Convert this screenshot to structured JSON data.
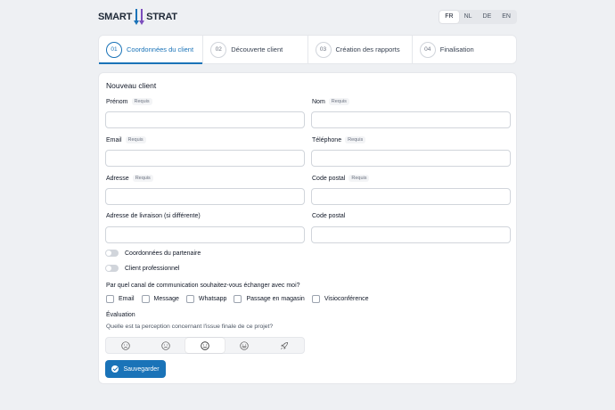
{
  "brand": {
    "left": "SMART",
    "right": "STRAT"
  },
  "languages": [
    {
      "code": "FR",
      "active": true
    },
    {
      "code": "NL",
      "active": false
    },
    {
      "code": "DE",
      "active": false
    },
    {
      "code": "EN",
      "active": false
    }
  ],
  "steps": [
    {
      "num": "01",
      "label": "Coordonnées du client",
      "active": true
    },
    {
      "num": "02",
      "label": "Découverte client",
      "active": false
    },
    {
      "num": "03",
      "label": "Création des rapports",
      "active": false
    },
    {
      "num": "04",
      "label": "Finalisation",
      "active": false
    }
  ],
  "form": {
    "title": "Nouveau client",
    "required_badge": "Requis",
    "fields": {
      "prenom": {
        "label": "Prénom",
        "value": ""
      },
      "nom": {
        "label": "Nom",
        "value": ""
      },
      "email": {
        "label": "Email",
        "value": ""
      },
      "telephone": {
        "label": "Téléphone",
        "value": ""
      },
      "adresse": {
        "label": "Adresse",
        "value": ""
      },
      "code_postal": {
        "label": "Code postal",
        "value": ""
      },
      "adresse_livraison": {
        "label": "Adresse de livraison (si différente)",
        "value": ""
      },
      "code_postal_livraison": {
        "label": "Code postal",
        "value": ""
      }
    },
    "toggles": {
      "partenaire": {
        "label": "Coordonnées du partenaire",
        "on": false
      },
      "professionnel": {
        "label": "Client professionnel",
        "on": false
      }
    },
    "channel_question": "Par quel canal de communication souhaitez-vous échanger avec moi?",
    "channels": [
      "Email",
      "Message",
      "Whatsapp",
      "Passage en magasin",
      "Visioconférence"
    ],
    "evaluation": {
      "title": "Évaluation",
      "question": "Quelle est ta perception concernant l'issue finale de ce projet?",
      "options": [
        "frown-icon",
        "meh-icon",
        "smile-icon",
        "laugh-icon",
        "rocket-icon"
      ],
      "selected_index": 2
    },
    "save_label": "Sauvegarder"
  },
  "colors": {
    "accent": "#1a73b8",
    "background": "#eef0f3"
  }
}
